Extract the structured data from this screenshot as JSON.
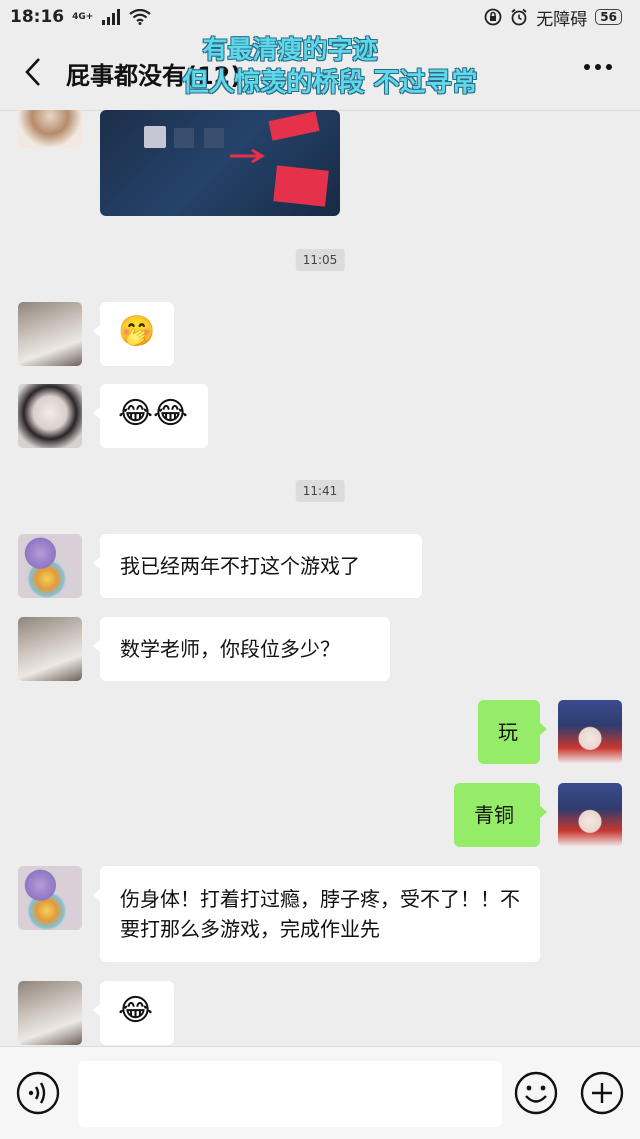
{
  "status": {
    "time": "18:16",
    "network": "4G+",
    "accessibility": "无障碍",
    "battery": "56"
  },
  "nav": {
    "title": "屁事都没有(12)",
    "overlay_line1": "有最清瘦的字迹",
    "overlay_line2": "但人惊羡的桥段 不过寻常"
  },
  "chat": {
    "timestamps": [
      "11:05",
      "11:41"
    ],
    "messages": [
      {
        "text": "🤭"
      },
      {
        "text": "😂😂"
      },
      {
        "text": "我已经两年不打这个游戏了"
      },
      {
        "text": "数学老师，你段位多少？"
      },
      {
        "text": "玩"
      },
      {
        "text": "青铜"
      },
      {
        "text": "伤身体！打着打过瘾，脖子疼，受不了！！不要打那么多游戏，完成作业先"
      },
      {
        "text": "😂"
      }
    ]
  },
  "input": {
    "placeholder": ""
  },
  "colors": {
    "bubble_self": "#95ec69",
    "overlay": "#5fd8ec",
    "background": "#ededed"
  }
}
